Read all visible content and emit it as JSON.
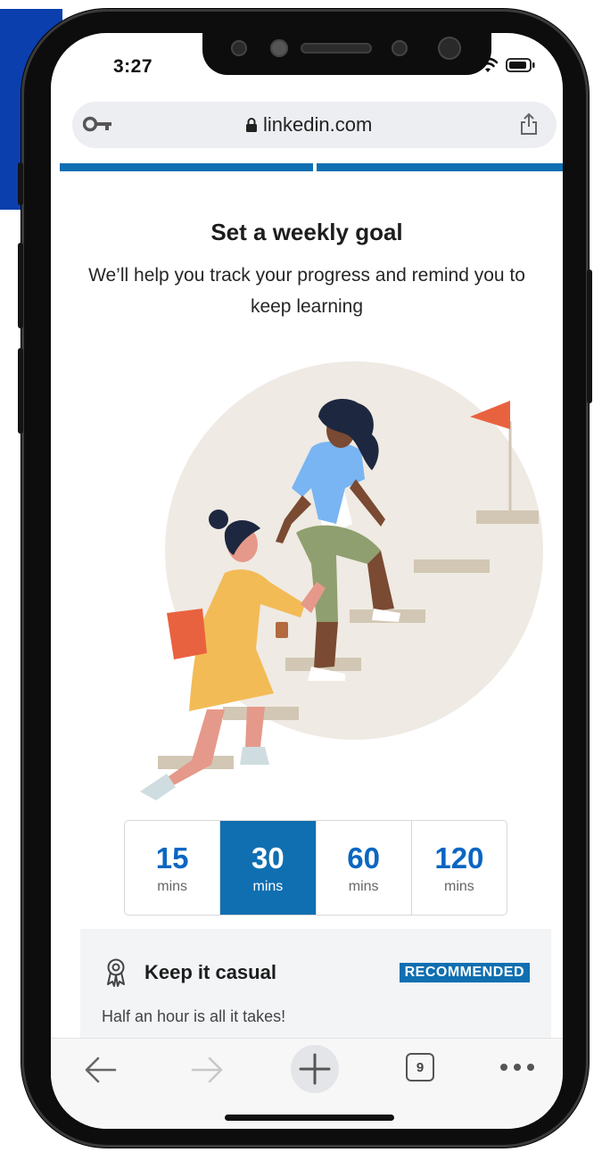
{
  "status": {
    "time": "3:27"
  },
  "browser": {
    "url": "linkedin.com",
    "tabs_count": "9",
    "progress_steps": 2,
    "progress_done": 2
  },
  "goal": {
    "title": "Set a weekly goal",
    "subtitle": "We’ll help you track your progress and remind you to keep learning",
    "options": [
      {
        "value": "15",
        "unit": "mins",
        "selected": false
      },
      {
        "value": "30",
        "unit": "mins",
        "selected": true
      },
      {
        "value": "60",
        "unit": "mins",
        "selected": false
      },
      {
        "value": "120",
        "unit": "mins",
        "selected": false
      }
    ]
  },
  "card": {
    "title": "Keep it casual",
    "badge": "RECOMMENDED",
    "description": "Half an hour is all it takes!"
  },
  "icons": [
    "key-icon",
    "lock-icon",
    "share-icon",
    "award-icon",
    "back-arrow-icon",
    "forward-arrow-icon",
    "plus-icon",
    "tabs-icon",
    "more-icon",
    "signal-icon",
    "wifi-icon",
    "battery-icon"
  ],
  "colors": {
    "accent": "#0f6fb1",
    "link_blue": "#0a66c2",
    "background_blue": "#0b3fae"
  }
}
